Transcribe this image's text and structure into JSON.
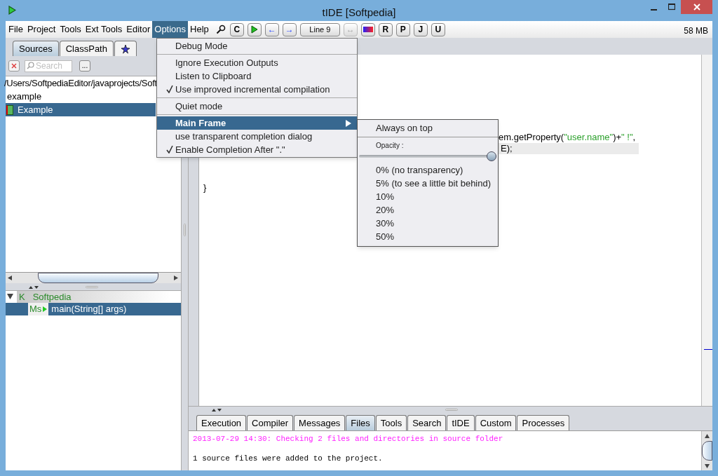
{
  "window": {
    "title": "tIDE [Softpedia]"
  },
  "menu_bar": [
    {
      "label": "File",
      "selected": false
    },
    {
      "label": "Project",
      "selected": false
    },
    {
      "label": "Tools",
      "selected": false
    },
    {
      "label": "Ext Tools",
      "selected": false
    },
    {
      "label": "Editor",
      "selected": false
    },
    {
      "label": "Options",
      "selected": true
    },
    {
      "label": "Help",
      "selected": false
    }
  ],
  "toolbar": [
    {
      "kind": "search"
    },
    {
      "kind": "text",
      "label": "C",
      "disabled": false
    },
    {
      "kind": "run"
    },
    {
      "kind": "text",
      "label": "←",
      "disabled": false
    },
    {
      "kind": "text",
      "label": "→",
      "disabled": false
    },
    {
      "kind": "wide",
      "label": "Line 9",
      "disabled": false
    },
    {
      "kind": "text",
      "label": "↔",
      "disabled": true
    },
    {
      "kind": "palette"
    },
    {
      "kind": "text",
      "label": "R",
      "disabled": false
    },
    {
      "kind": "text",
      "label": "P",
      "disabled": false
    },
    {
      "kind": "text",
      "label": "J",
      "disabled": false
    },
    {
      "kind": "text",
      "label": "U",
      "disabled": false
    }
  ],
  "memory": "58 MB",
  "left_tabs": [
    {
      "label": "Sources",
      "selected": true
    },
    {
      "label": "ClassPath",
      "selected": false
    },
    {
      "kind": "star",
      "selected": false
    }
  ],
  "search": {
    "placeholder": "Search",
    "more": "..."
  },
  "sources": [
    {
      "kind": "path",
      "label": "/Users/SoftpediaEditor/javaprojects/Soft",
      "selected": false
    },
    {
      "kind": "package",
      "label": "example",
      "selected": false
    },
    {
      "kind": "file",
      "label": "Example",
      "selected": true
    }
  ],
  "structure": [
    {
      "prefix": "K",
      "label": "Softpedia",
      "expanded": true,
      "selected": false,
      "children": [
        {
          "prefix": "Ms",
          "label": "main(String[] args)",
          "selected": true
        }
      ]
    }
  ],
  "editor": {
    "lines": [
      {
        "current": false,
        "parts": [
          {
            "kind": "code",
            "text": "em.getProperty("
          },
          {
            "kind": "string",
            "text": "\"user.name\""
          },
          {
            "kind": "code",
            "text": ")+"
          },
          {
            "kind": "string",
            "text": "\" !\""
          },
          {
            "kind": "code",
            "text": ","
          }
        ]
      },
      {
        "current": true,
        "parts": [
          {
            "kind": "code",
            "text": "E);"
          }
        ]
      },
      {
        "current": false,
        "parts": [
          {
            "kind": "code",
            "text": "}"
          }
        ]
      }
    ]
  },
  "bottom_tabs": [
    {
      "label": "Execution",
      "selected": false
    },
    {
      "label": "Compiler",
      "selected": false
    },
    {
      "label": "Messages",
      "selected": false
    },
    {
      "label": "Files",
      "selected": true
    },
    {
      "label": "Tools",
      "selected": false
    },
    {
      "label": "Search",
      "selected": false
    },
    {
      "label": "tIDE",
      "selected": false
    },
    {
      "label": "Custom",
      "selected": false
    },
    {
      "label": "Processes",
      "selected": false
    }
  ],
  "output": [
    {
      "kind": "info",
      "text": "2013-07-29 14:30: Checking 2 files and directories in source folder"
    },
    {
      "kind": "blank"
    },
    {
      "kind": "plain",
      "text": "1 source files were added to the project."
    }
  ],
  "options_menu": [
    [
      {
        "label": "Debug Mode",
        "checked": false,
        "selected": false,
        "submenu": false
      }
    ],
    [
      {
        "label": "Ignore Execution Outputs",
        "checked": false,
        "selected": false,
        "submenu": false
      },
      {
        "label": "Listen to Clipboard",
        "checked": false,
        "selected": false,
        "submenu": false
      },
      {
        "label": "Use improved incremental compilation",
        "checked": true,
        "selected": false,
        "submenu": false
      }
    ],
    [
      {
        "label": "Quiet mode",
        "checked": false,
        "selected": false,
        "submenu": false
      }
    ],
    [
      {
        "label": "Main Frame",
        "checked": false,
        "selected": true,
        "submenu": true
      },
      {
        "label": "use transparent completion dialog",
        "checked": false,
        "selected": false,
        "submenu": false
      },
      {
        "label": "Enable Completion After \".\"",
        "checked": true,
        "selected": false,
        "submenu": false
      }
    ]
  ],
  "main_frame_menu": {
    "top": "Always on top",
    "opacity_label": "Opacity :",
    "level": 1,
    "options": [
      "0% (no transparency)",
      "5% (to see a little bit behind)",
      "10%",
      "20%",
      "30%",
      "50%"
    ]
  }
}
